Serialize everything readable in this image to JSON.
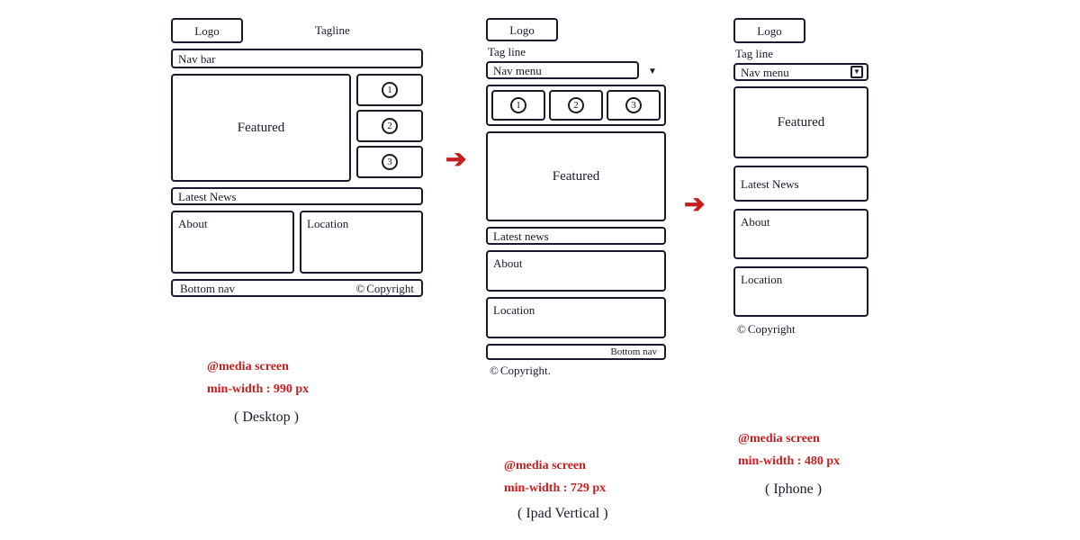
{
  "common": {
    "logo": "Logo",
    "tagline": "Tagline",
    "tagline_alt": "Tag line",
    "navbar": "Nav bar",
    "navmenu": "Nav menu",
    "featured": "Featured",
    "latest": "Latest News",
    "latest_alt": "Latest news",
    "about": "About",
    "location": "Location",
    "bottomnav": "Bottom nav",
    "copyright": "Copyright",
    "copyright_dot": "Copyright.",
    "one": "1",
    "two": "2",
    "three": "3"
  },
  "captions": {
    "desktop_rule1": "@media screen",
    "desktop_rule2": "min-width : 990 px",
    "desktop_device": "( Desktop )",
    "ipad_rule1": "@media screen",
    "ipad_rule2": "min-width : 729 px",
    "ipad_device": "( Ipad Vertical )",
    "iphone_rule1": "@media screen",
    "iphone_rule2": "min-width : 480 px",
    "iphone_device": "( Iphone )"
  }
}
